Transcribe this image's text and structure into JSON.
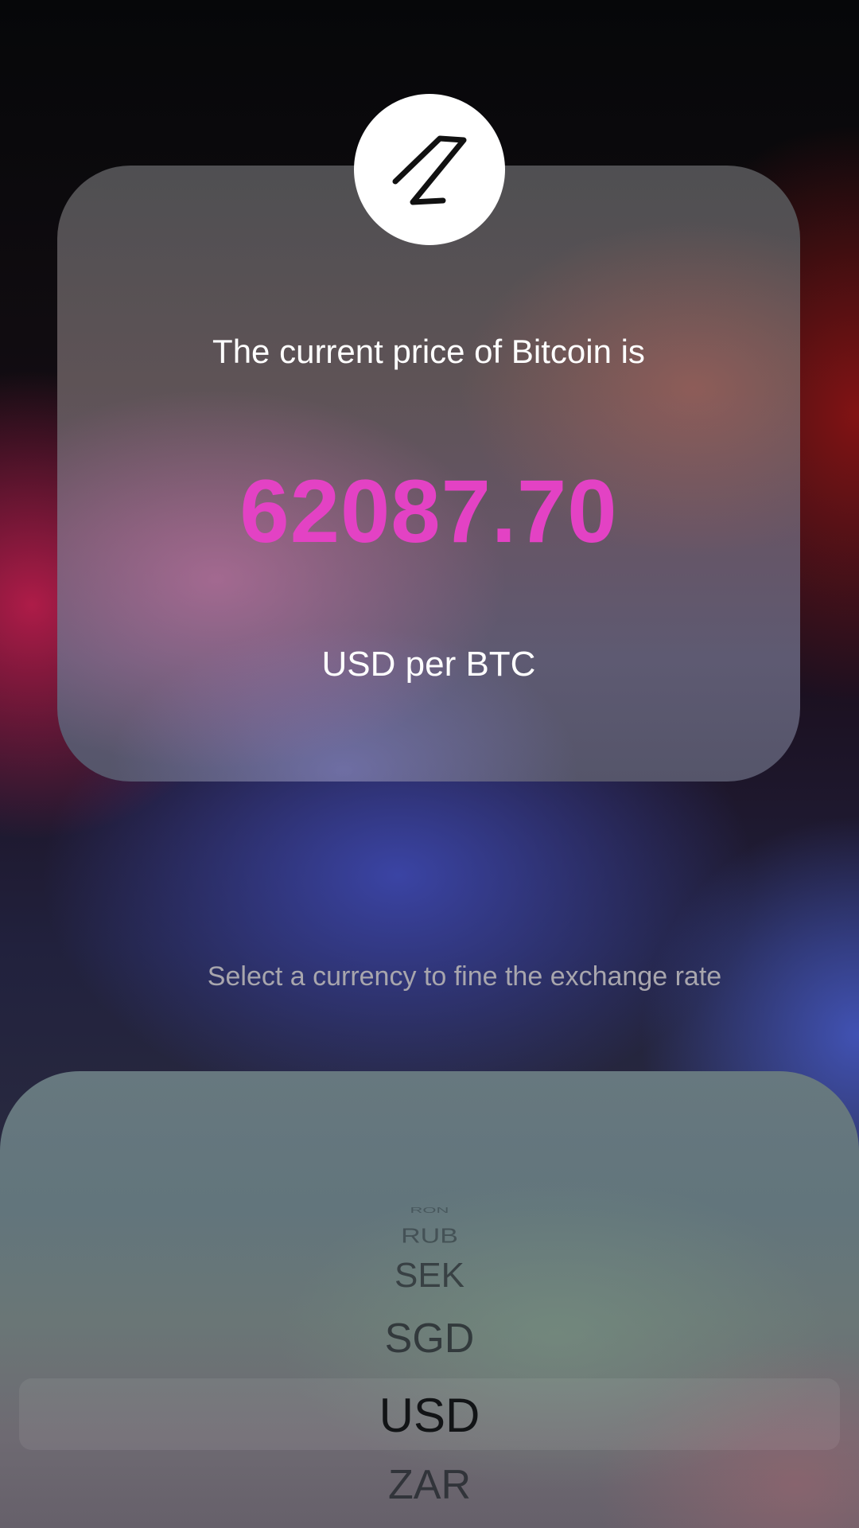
{
  "app": {
    "logo_icon": "z-logo-icon"
  },
  "price_card": {
    "label": "The current price of Bitcoin is",
    "value": "62087.70",
    "unit": "USD per BTC",
    "value_color": "#e342c4"
  },
  "instruction": "Select a currency to fine the exchange rate",
  "picker": {
    "items": [
      "RON",
      "RUB",
      "SEK",
      "SGD",
      "USD",
      "ZAR"
    ],
    "selected": "USD"
  }
}
